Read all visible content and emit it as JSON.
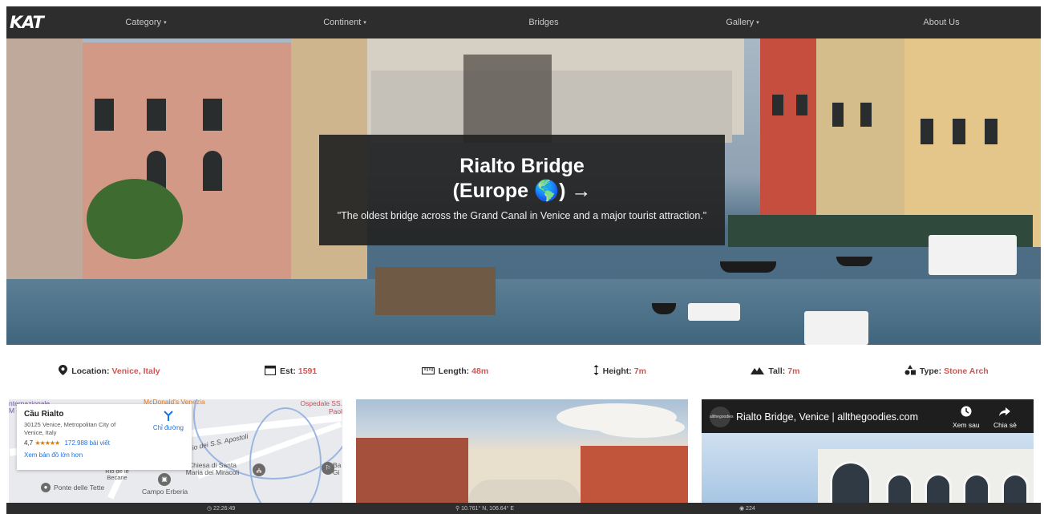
{
  "nav": {
    "logo": "KAT",
    "items": [
      {
        "label": "Category",
        "dropdown": true
      },
      {
        "label": "Continent",
        "dropdown": true
      },
      {
        "label": "Bridges",
        "dropdown": false
      },
      {
        "label": "Gallery",
        "dropdown": true
      },
      {
        "label": "About Us",
        "dropdown": false
      }
    ],
    "caret": "▾"
  },
  "hero": {
    "title": "Rialto Bridge",
    "subtitle": "(Europe 🌎) →",
    "description": "\"The oldest bridge across the Grand Canal in Venice and a major tourist attraction.\""
  },
  "info": {
    "location": {
      "label": "Location:",
      "value": "Venice, Italy",
      "icon": "map-pin-icon"
    },
    "est": {
      "label": "Est:",
      "value": "1591",
      "icon": "calendar-icon"
    },
    "length": {
      "label": "Length:",
      "value": "48m",
      "icon": "ruler-icon"
    },
    "height": {
      "label": "Height:",
      "value": "7m",
      "icon": "vertical-arrows-icon"
    },
    "tall": {
      "label": "Tall:",
      "value": "7m",
      "icon": "mountain-icon"
    },
    "type": {
      "label": "Type:",
      "value": "Stone Arch",
      "icon": "shapes-icon"
    }
  },
  "map": {
    "place_name": "Cầu Rialto",
    "address": "30125 Venice, Metropolitan City of Venice, Italy",
    "rating": "4,7",
    "stars": "★★★★★",
    "reviews": "172.988 bài viết",
    "directions": "Chỉ đường",
    "view_larger": "Xem bản đồ lớn hơn",
    "labels": {
      "internazionale": "nternazionale",
      "mcdonalds": "McDonald's Venezia",
      "ospedale": "Ospedale SS. Paol",
      "apostoli": "io dei S.S. Apostoli",
      "chiesa": "Chiesa di Santa Maria dei Miracoli",
      "ponte": "Ponte delle Tette",
      "campo": "Campo Erberia",
      "rio": "Rio de le Becarie",
      "m": "M",
      "ba": "Ba Gi"
    }
  },
  "video": {
    "channel": "allthegoodies",
    "title": "Rialto Bridge, Venice | allthegoodies.com",
    "watch_later": "Xem sau",
    "share": "Chia sẻ"
  },
  "status": {
    "time": "◷ 22:26:49",
    "coords": "⚲ 10.761° N, 106.64° E",
    "views": "◉ 224"
  },
  "colors": {
    "nav_bg": "#2d2d2d",
    "accent": "#d9534f",
    "card_bg": "#232323"
  }
}
